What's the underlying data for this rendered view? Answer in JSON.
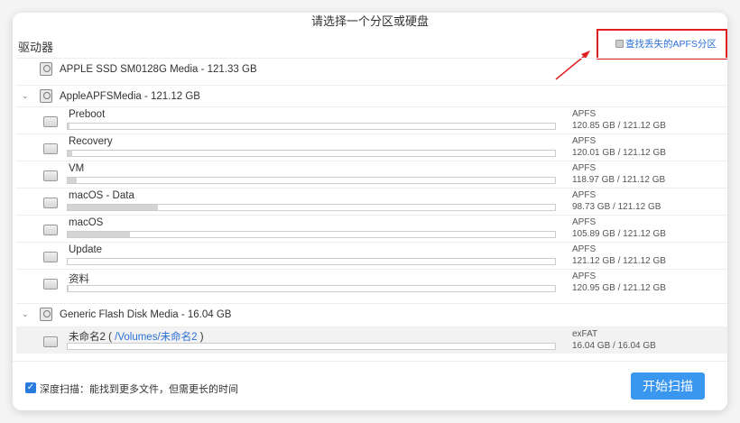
{
  "title": "请选择一个分区或硬盘",
  "drives_label": "驱动器",
  "find_lost_apfs": "查找丢失的APFS分区",
  "drives": [
    {
      "name": "APPLE SSD SM0128G Media - 121.33 GB",
      "expandable": false
    },
    {
      "name": "AppleAPFSMedia - 121.12 GB",
      "expandable": true
    },
    {
      "name": "Generic Flash Disk Media - 16.04 GB",
      "expandable": true
    }
  ],
  "partitions": [
    {
      "name": "Preboot",
      "fs": "APFS",
      "size": "120.85 GB / 121.12 GB",
      "used_pct": 0.3
    },
    {
      "name": "Recovery",
      "fs": "APFS",
      "size": "120.01 GB / 121.12 GB",
      "used_pct": 1
    },
    {
      "name": "VM",
      "fs": "APFS",
      "size": "118.97 GB / 121.12 GB",
      "used_pct": 1.8
    },
    {
      "name": "macOS - Data",
      "fs": "APFS",
      "size": "98.73 GB / 121.12 GB",
      "used_pct": 18.6
    },
    {
      "name": "macOS",
      "fs": "APFS",
      "size": "105.89 GB / 121.12 GB",
      "used_pct": 12.7
    },
    {
      "name": "Update",
      "fs": "APFS",
      "size": "121.12 GB / 121.12 GB",
      "used_pct": 0
    },
    {
      "name": "资料",
      "fs": "APFS",
      "size": "120.95 GB / 121.12 GB",
      "used_pct": 0.2
    }
  ],
  "usb_partition": {
    "name": "未命名2",
    "open": " ( ",
    "path": "/Volumes/未命名2",
    "close": " )",
    "fs": "exFAT",
    "size": "16.04 GB / 16.04 GB",
    "used_pct": 0
  },
  "deep_scan": {
    "checked": true,
    "label": "深度扫描：能找到更多文件，但需更长的时间"
  },
  "start_button": "开始扫描"
}
